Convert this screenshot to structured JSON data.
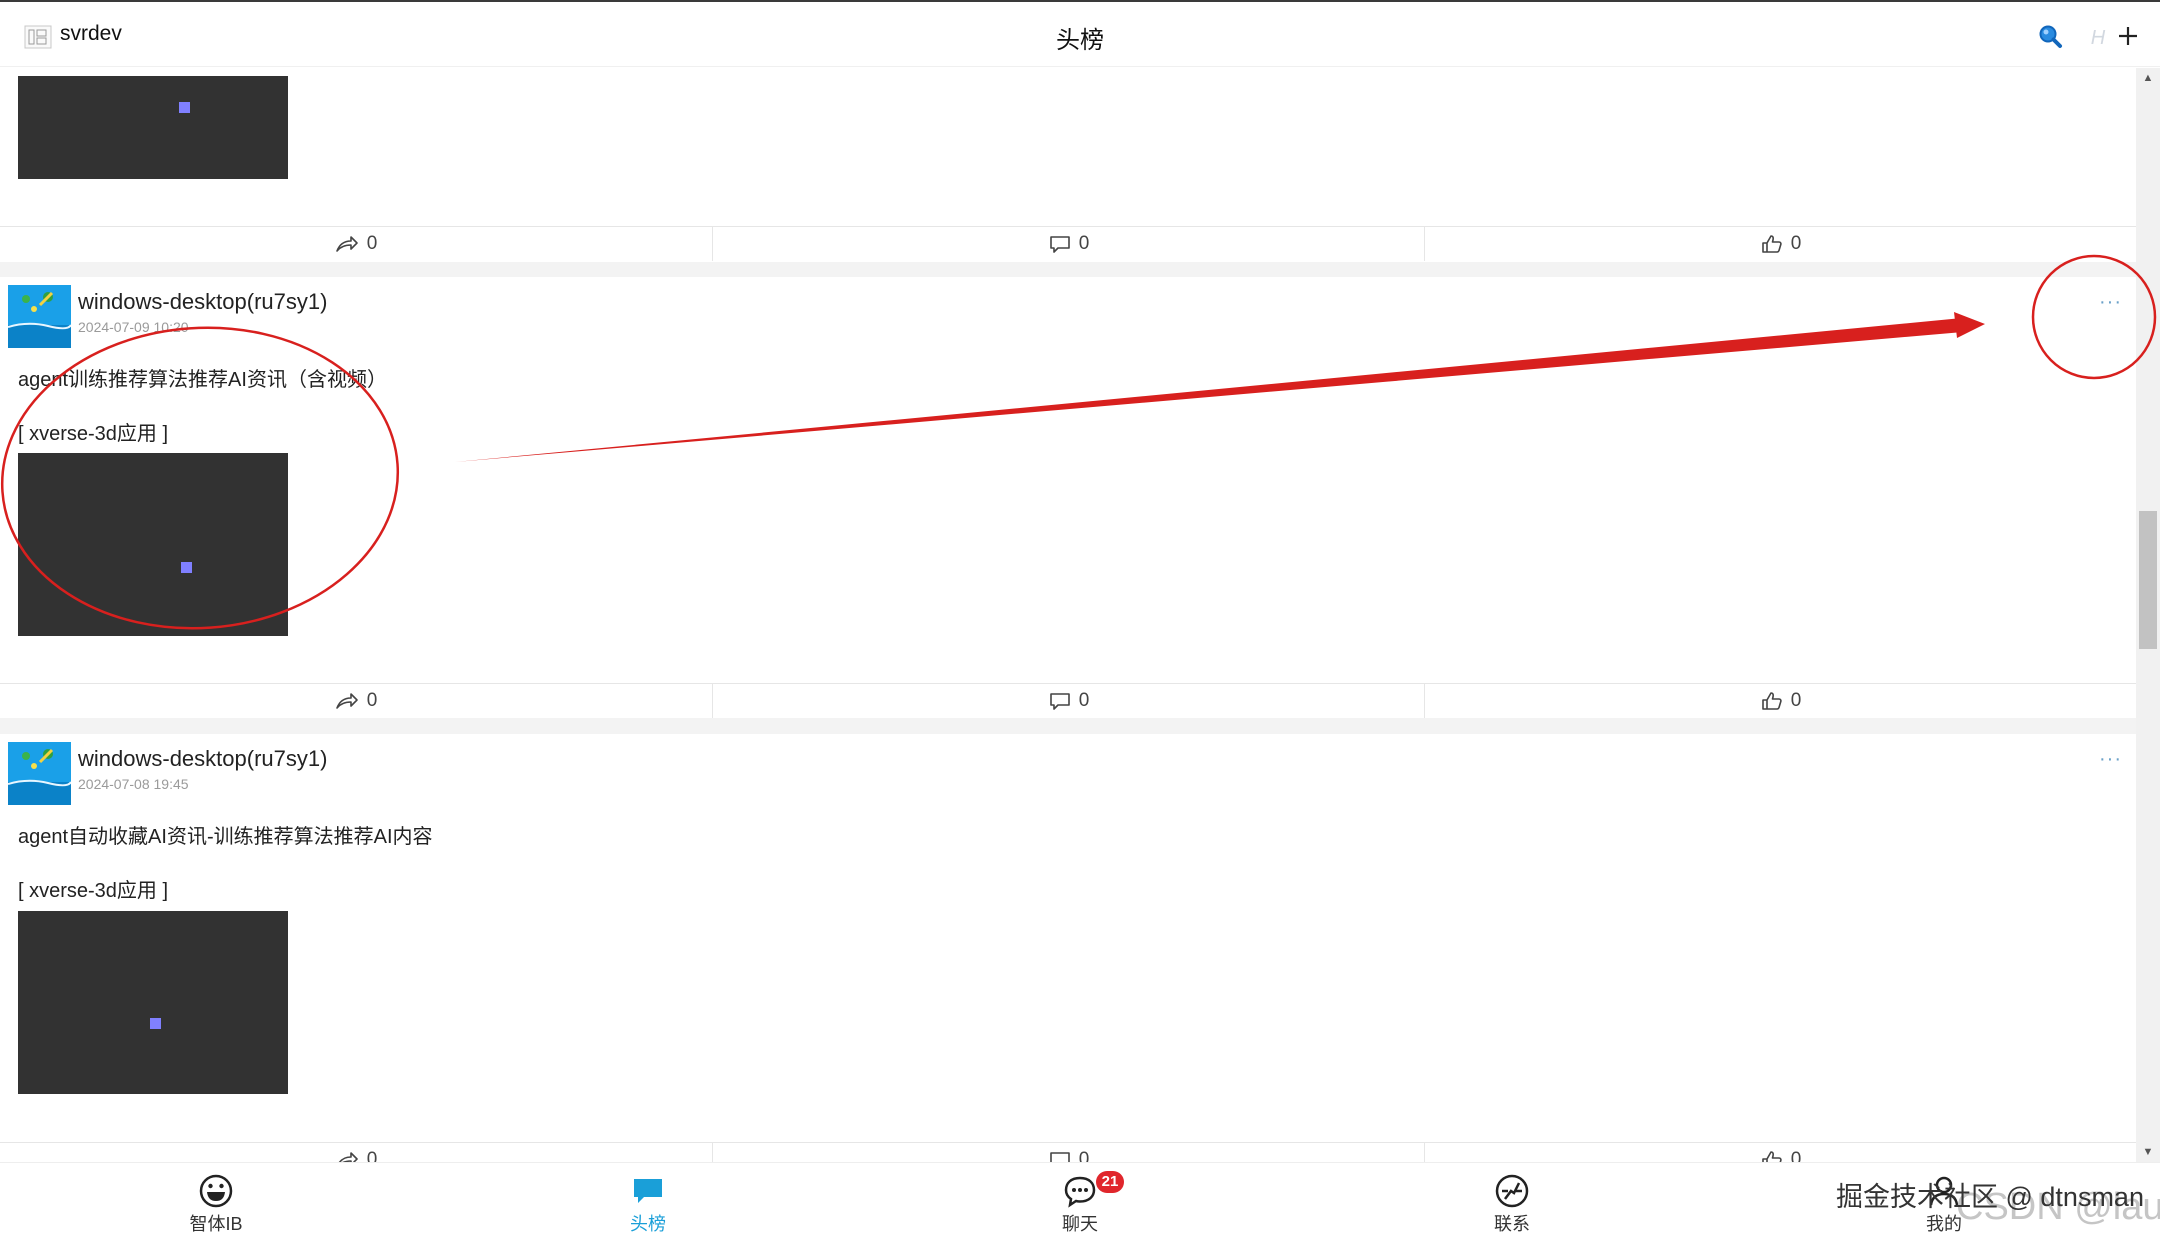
{
  "header": {
    "app_name": "svrdev",
    "title": "头榜",
    "icons": [
      "search-icon",
      "h-icon",
      "plus-icon"
    ],
    "h_label": "H"
  },
  "posts": [
    {
      "actions": {
        "share": "0",
        "comment": "0",
        "like": "0"
      }
    },
    {
      "author": "windows-desktop(ru7sy1)",
      "time": "2024-07-09 10:20",
      "text": "agent训练推荐算法推荐AI资讯（含视频）",
      "app_tag": "[ xverse-3d应用 ]",
      "more": "···",
      "actions": {
        "share": "0",
        "comment": "0",
        "like": "0"
      }
    },
    {
      "author": "windows-desktop(ru7sy1)",
      "time": "2024-07-08 19:45",
      "text": "agent自动收藏AI资讯-训练推荐算法推荐AI内容",
      "app_tag": "[ xverse-3d应用 ]",
      "more": "···",
      "actions": {
        "share": "0",
        "comment": "0",
        "like": "0"
      }
    }
  ],
  "tabs": [
    {
      "label": "智体IB",
      "icon": "smiley-icon"
    },
    {
      "label": "头榜",
      "icon": "feed-icon",
      "active": true
    },
    {
      "label": "聊天",
      "icon": "chat-icon",
      "badge": "21"
    },
    {
      "label": "联系",
      "icon": "contact-icon"
    },
    {
      "label": "我的",
      "icon": "user-icon"
    }
  ],
  "watermark": "掘金技术社区 @ dtnsman",
  "watermark2": "CSDN @lauo",
  "colors": {
    "accent": "#1a9fd8",
    "annotation": "#d8201e",
    "badge": "#e0262c",
    "media_bg": "#323232",
    "media_dot": "#8080ff"
  }
}
